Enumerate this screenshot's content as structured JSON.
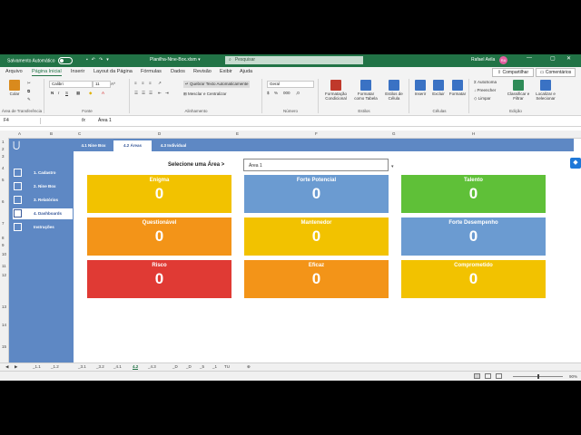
{
  "titlebar": {
    "autosave_label": "Salvamento Automático",
    "doc_title": "Planilha-Nine-Box.xlsm",
    "search_placeholder": "Pesquisar",
    "user_name": "Rafael Avila",
    "user_initials": "RA"
  },
  "menu": {
    "tabs": [
      "Arquivo",
      "Página Inicial",
      "Inserir",
      "Layout da Página",
      "Fórmulas",
      "Dados",
      "Revisão",
      "Exibir",
      "Ajuda"
    ],
    "share_label": "Compartilhar",
    "comments_label": "Comentários"
  },
  "ribbon": {
    "paste_label": "Colar",
    "clipboard_group": "Área de Transferência",
    "font_name": "Calibri",
    "font_size": "11",
    "font_group": "Fonte",
    "wrap_text": "Quebrar Texto Automaticamente",
    "merge_center": "Mesclar e Centralizar",
    "alignment_group": "Alinhamento",
    "number_format": "Geral",
    "number_group": "Número",
    "cond_format": "Formatação Condicional",
    "format_table": "Formatar como Tabela",
    "cell_styles": "Estilos de Célula",
    "styles_group": "Estilos",
    "insert_label": "Inserir",
    "delete_label": "Excluir",
    "format_label": "Formatar",
    "cells_group": "Células",
    "autosum": "AutoSoma",
    "fill": "Preencher",
    "clear": "Limpar",
    "sort_filter": "Classificar e Filtrar",
    "find_select": "Localizar e Selecionar",
    "editing_group": "Edição"
  },
  "formula_bar": {
    "cell_ref": "F4",
    "fx": "fx",
    "value": "Área 1"
  },
  "columns": [
    "A",
    "B",
    "C",
    "D",
    "E",
    "F",
    "G",
    "H"
  ],
  "rows": [
    "1",
    "2",
    "3",
    "4",
    "5",
    "6",
    "7",
    "8",
    "9",
    "10",
    "11",
    "12",
    "13",
    "14",
    "15"
  ],
  "sidebar": {
    "items": [
      {
        "label": "1. Cadastro",
        "icon": "form-icon"
      },
      {
        "label": "2. Nine Box",
        "icon": "grid-icon"
      },
      {
        "label": "3. Relatórios",
        "icon": "report-icon"
      },
      {
        "label": "4. Dashboards",
        "icon": "chart-icon"
      },
      {
        "label": "Instruções",
        "icon": "book-icon"
      }
    ]
  },
  "top_tabs": [
    "4.1 Nine Box",
    "4.2 Áreas",
    "4.3 Individual"
  ],
  "selector": {
    "label": "Selecione uma Área >",
    "value": "Área 1"
  },
  "cards": [
    {
      "title": "Enigma",
      "value": "0",
      "color": "#f2c200"
    },
    {
      "title": "Forte Potencial",
      "value": "0",
      "color": "#6b9bd1"
    },
    {
      "title": "Talento",
      "value": "0",
      "color": "#5fc038"
    },
    {
      "title": "Questionável",
      "value": "0",
      "color": "#f39418"
    },
    {
      "title": "Mantenedor",
      "value": "0",
      "color": "#f2c200"
    },
    {
      "title": "Forte Desempenho",
      "value": "0",
      "color": "#6b9bd1"
    },
    {
      "title": "Risco",
      "value": "0",
      "color": "#e03a34"
    },
    {
      "title": "Eficaz",
      "value": "0",
      "color": "#f39418"
    },
    {
      "title": "Comprometido",
      "value": "0",
      "color": "#f2c200"
    }
  ],
  "sheet_tabs": [
    "_1.1",
    "_1.2",
    "_3.1",
    "_3.2",
    "_4.1",
    "4.2",
    "_4.3",
    "_D",
    "_D",
    "_5",
    "_1",
    "TU"
  ],
  "status": {
    "zoom": "90%"
  }
}
